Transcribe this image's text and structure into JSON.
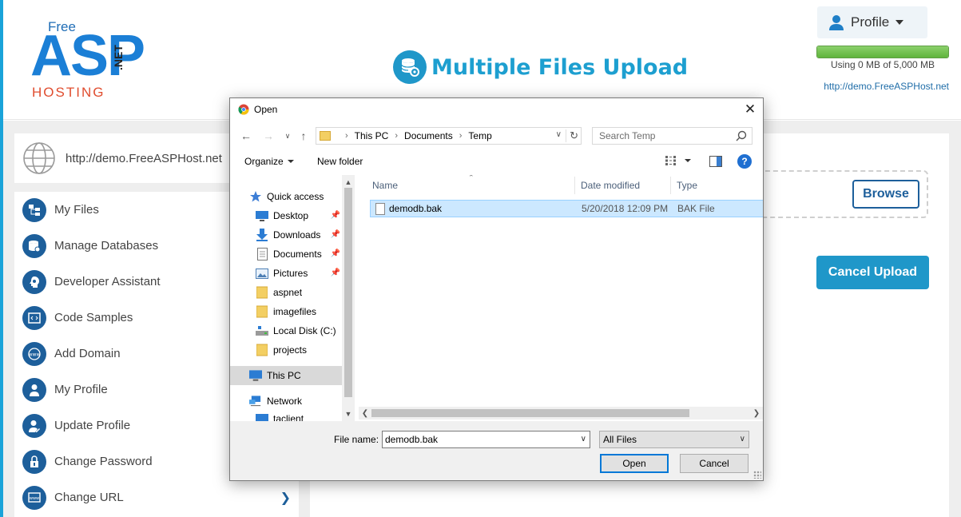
{
  "header": {
    "logo": {
      "free": "Free",
      "asp": "ASP",
      "hosting": "HOSTING",
      "net": ".NET"
    },
    "page_title": "Multiple Files Upload",
    "profile_label": "Profile",
    "usage_text": "Using 0 MB of 5,000 MB",
    "usage_fraction": 1.0,
    "site_url": "http://demo.FreeASPHost.net"
  },
  "url_box": {
    "url": "http://demo.FreeASPHost.net"
  },
  "sidebar": {
    "items": [
      {
        "label": "My Files",
        "icon": "files-icon"
      },
      {
        "label": "Manage Databases",
        "icon": "database-icon"
      },
      {
        "label": "Developer Assistant",
        "icon": "head-gear-icon"
      },
      {
        "label": "Code Samples",
        "icon": "code-icon"
      },
      {
        "label": "Add Domain",
        "icon": "www-icon"
      },
      {
        "label": "My Profile",
        "icon": "user-icon"
      },
      {
        "label": "Update Profile",
        "icon": "user-edit-icon"
      },
      {
        "label": "Change Password",
        "icon": "lock-icon"
      },
      {
        "label": "Change URL",
        "icon": "url-icon"
      }
    ]
  },
  "upload": {
    "browse_label": "Browse",
    "cancel_upload_label": "Cancel Upload"
  },
  "dialog": {
    "title": "Open",
    "breadcrumb": [
      "This PC",
      "Documents",
      "Temp"
    ],
    "search_placeholder": "Search Temp",
    "organize_label": "Organize",
    "new_folder_label": "New folder",
    "nav_items": [
      {
        "label": "Quick access",
        "icon": "star-icon",
        "pinned": false
      },
      {
        "label": "Desktop",
        "icon": "desktop-icon",
        "pinned": true
      },
      {
        "label": "Downloads",
        "icon": "download-icon",
        "pinned": true
      },
      {
        "label": "Documents",
        "icon": "document-icon",
        "pinned": true
      },
      {
        "label": "Pictures",
        "icon": "picture-icon",
        "pinned": true
      },
      {
        "label": "aspnet",
        "icon": "folder-icon",
        "pinned": false
      },
      {
        "label": "imagefiles",
        "icon": "folder-icon",
        "pinned": false
      },
      {
        "label": "Local Disk (C:)",
        "icon": "drive-icon",
        "pinned": false
      },
      {
        "label": "projects",
        "icon": "folder-icon",
        "pinned": false
      },
      {
        "label": "This PC",
        "icon": "computer-icon",
        "pinned": false
      },
      {
        "label": "Network",
        "icon": "network-icon",
        "pinned": false
      },
      {
        "label": "taclient",
        "icon": "computer-icon",
        "pinned": false
      }
    ],
    "columns": [
      "Name",
      "Date modified",
      "Type"
    ],
    "files": [
      {
        "name": "demodb.bak",
        "date": "5/20/2018 12:09 PM",
        "type": "BAK File"
      }
    ],
    "file_name_label": "File name:",
    "file_name_value": "demodb.bak",
    "filter_value": "All Files",
    "open_label": "Open",
    "cancel_label": "Cancel"
  }
}
